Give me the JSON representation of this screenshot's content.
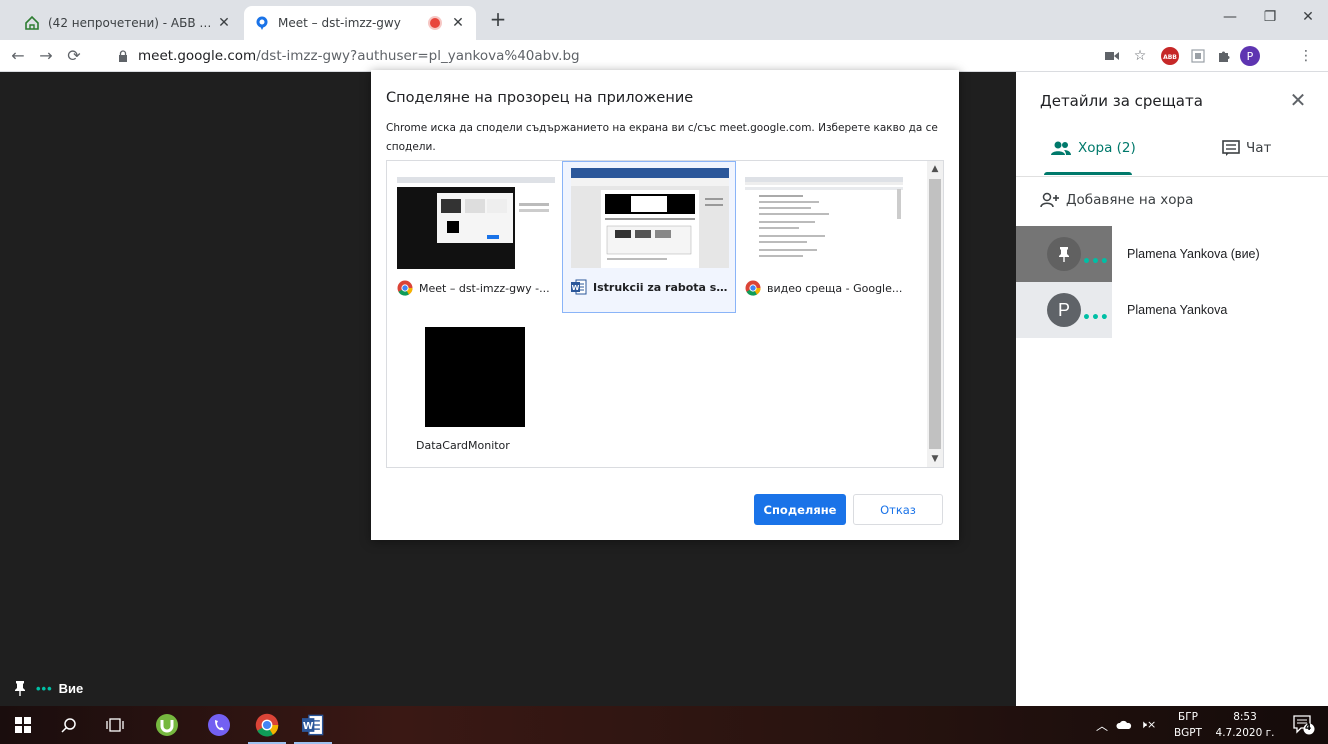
{
  "browser": {
    "tabs": [
      {
        "title": "(42 непрочетени) - АБВ поща",
        "icon": "abv-house-icon",
        "active": false
      },
      {
        "title": "Meet – dst-imzz-gwy",
        "icon": "meet-icon",
        "active": true,
        "recording": true
      }
    ],
    "url_host": "meet.google.com",
    "url_path": "/dst-imzz-gwy?authuser=pl_yankova%40abv.bg",
    "profile_initial": "P"
  },
  "meet": {
    "self_label": "Вие",
    "panel": {
      "title": "Детайли за срещата",
      "tab_people": "Хора (2)",
      "tab_chat": "Чат",
      "add_people": "Добавяне на хора",
      "participants": [
        {
          "name": "Plamena Yankova (вие)",
          "avatar": "pin-icon",
          "bg": "#757575"
        },
        {
          "name": "Plamena Yankova",
          "initial": "P",
          "bg": "#e8eaed"
        }
      ]
    }
  },
  "dialog": {
    "title": "Споделяне на прозорец на приложение",
    "description": "Chrome иска да сподели съдържанието на екрана ви с/със meet.google.com. Изберете какво да се сподели.",
    "windows": [
      {
        "label": "Meet – dst-imzz-gwy -...",
        "app_icon": "chrome-icon",
        "selected": false
      },
      {
        "label": "Istrukcii za rabota s G...",
        "app_icon": "word-icon",
        "selected": true
      },
      {
        "label": "видео среща - Google...",
        "app_icon": "chrome-icon",
        "selected": false
      },
      {
        "label": "DataCardMonitor",
        "app_icon": "",
        "selected": false
      }
    ],
    "share_button": "Споделяне",
    "cancel_button": "Отказ"
  },
  "taskbar": {
    "lang_top": "БГР",
    "lang_bottom": "BGPT",
    "time": "8:53",
    "date": "4.7.2020 г.",
    "notifications": "4"
  }
}
